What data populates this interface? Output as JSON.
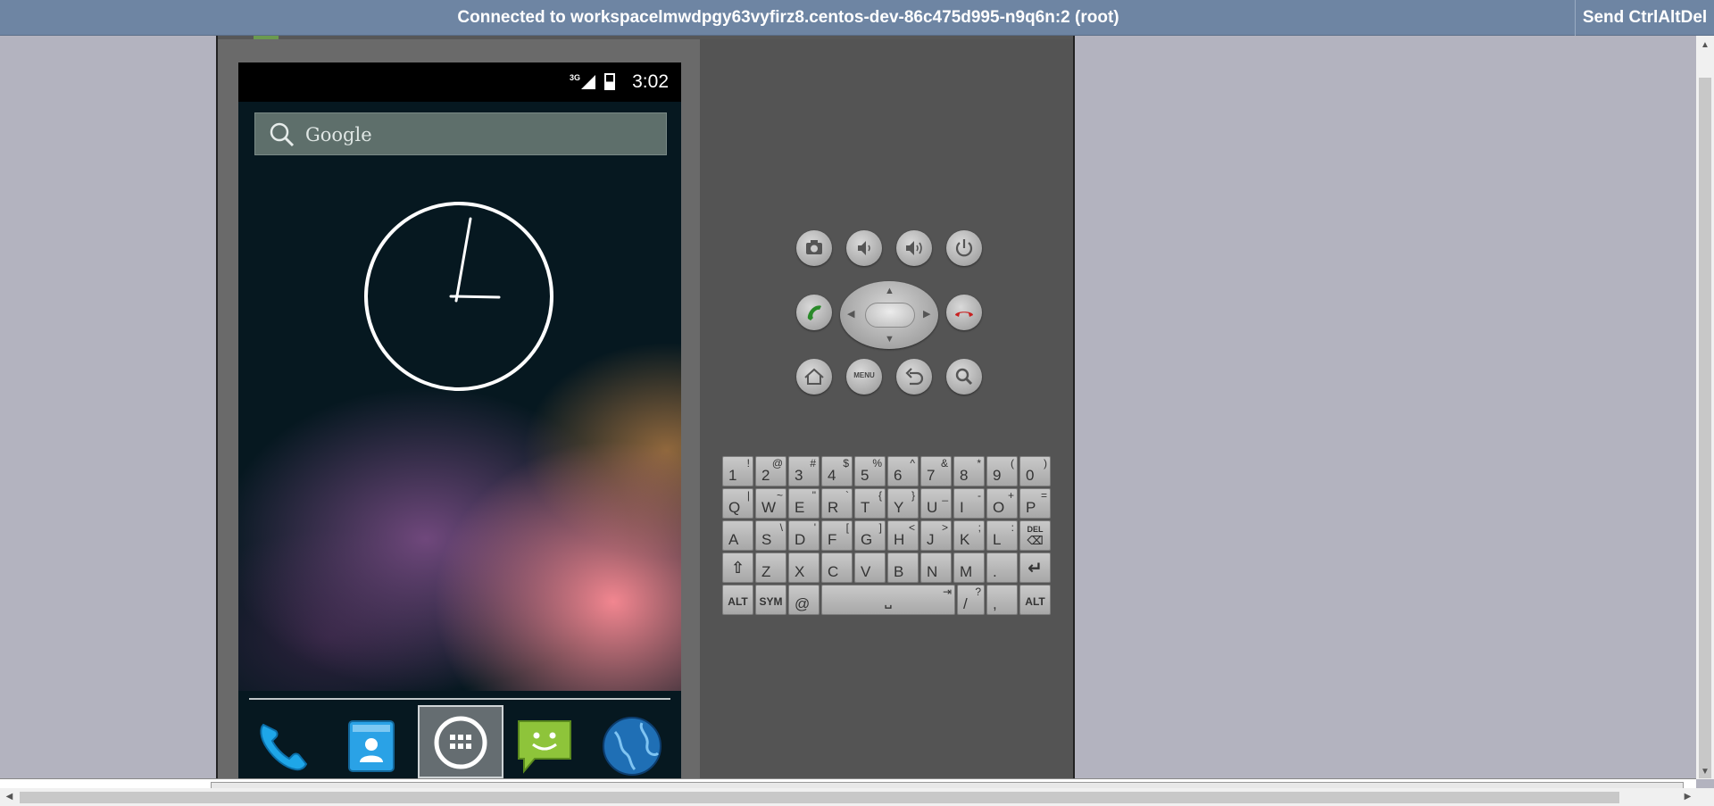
{
  "topbar": {
    "title": "Connected to workspacelmwdpgy63vyfirz8.centos-dev-86c475d995-n9q6n:2 (root)",
    "send_cad_label": "Send CtrlAltDel"
  },
  "phone": {
    "status": {
      "network": "3G",
      "time": "3:02"
    },
    "search_placeholder": "Google",
    "dock": [
      "phone-icon",
      "contacts-icon",
      "apps-icon",
      "messaging-icon",
      "browser-icon"
    ]
  },
  "controls": {
    "menu_label": "MENU"
  },
  "keyboard": {
    "row1": [
      {
        "m": "1",
        "s": "!"
      },
      {
        "m": "2",
        "s": "@"
      },
      {
        "m": "3",
        "s": "#"
      },
      {
        "m": "4",
        "s": "$"
      },
      {
        "m": "5",
        "s": "%"
      },
      {
        "m": "6",
        "s": "^"
      },
      {
        "m": "7",
        "s": "&"
      },
      {
        "m": "8",
        "s": "*"
      },
      {
        "m": "9",
        "s": "("
      },
      {
        "m": "0",
        "s": ")"
      }
    ],
    "row2": [
      {
        "m": "Q",
        "s": "|"
      },
      {
        "m": "W",
        "s": "~"
      },
      {
        "m": "E",
        "s": "\""
      },
      {
        "m": "R",
        "s": "`"
      },
      {
        "m": "T",
        "s": "{"
      },
      {
        "m": "Y",
        "s": "}"
      },
      {
        "m": "U",
        "s": "_"
      },
      {
        "m": "I",
        "s": "-"
      },
      {
        "m": "O",
        "s": "+"
      },
      {
        "m": "P",
        "s": "="
      }
    ],
    "row3": [
      {
        "m": "A",
        "s": ""
      },
      {
        "m": "S",
        "s": "\\"
      },
      {
        "m": "D",
        "s": "'"
      },
      {
        "m": "F",
        "s": "["
      },
      {
        "m": "G",
        "s": "]"
      },
      {
        "m": "H",
        "s": "<"
      },
      {
        "m": "J",
        "s": ">"
      },
      {
        "m": "K",
        "s": ";"
      },
      {
        "m": "L",
        "s": ":"
      },
      {
        "m": "",
        "s": "DEL"
      }
    ],
    "row4": [
      {
        "m": "",
        "s": ""
      },
      {
        "m": "Z",
        "s": ""
      },
      {
        "m": "X",
        "s": ""
      },
      {
        "m": "C",
        "s": ""
      },
      {
        "m": "V",
        "s": ""
      },
      {
        "m": "B",
        "s": ""
      },
      {
        "m": "N",
        "s": ""
      },
      {
        "m": "M",
        "s": ""
      },
      {
        "m": ".",
        "s": ""
      },
      {
        "m": "",
        "s": ""
      }
    ],
    "alt_label": "ALT",
    "sym_label": "SYM",
    "at_label": "@",
    "slash": {
      "m": "/",
      "s": "?"
    },
    "comma": {
      "m": ",",
      "s": ""
    }
  }
}
